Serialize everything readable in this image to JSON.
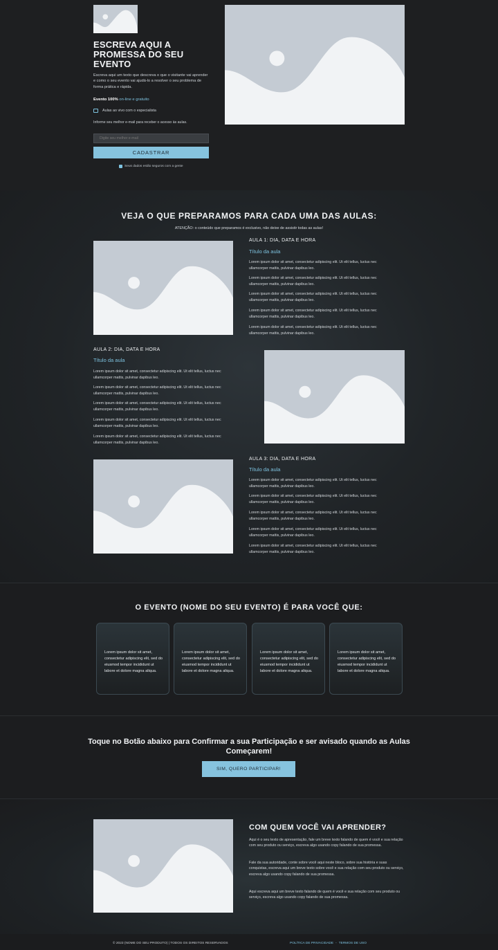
{
  "hero": {
    "title": "ESCREVA AQUI A PROMESSA DO SEU EVENTO",
    "description": "Escreva aqui um texto que descreva o que o visitante vai aprender e como o seu evento vai ajudá-lo a resolver o seu problema de forma prática e rápida.",
    "free_prefix": "Evento 100%",
    "free_highlight": "on-line e gratuito",
    "live_text": "Aulas ao vivo com o especialista",
    "info_text": "Informe seu melhor e-mail para receber o acesso às aulas.",
    "email_placeholder": "Digite seu melhor e-mail",
    "submit_label": "CADASTRAR",
    "secure_text": "Seus dados estão seguros com a gente"
  },
  "aulas": {
    "title": "VEJA O QUE PREPARAMOS PARA CADA UMA DAS AULAS:",
    "subtitle": "ATENÇÃO: o conteúdo que preparamos é exclusivo, não deixe de assistir todas as aulas!",
    "items": [
      {
        "heading": "AULA 1: DIA, DATA E HORA",
        "subtitle": "Título da aula",
        "paragraphs": [
          "Lorem ipsum dolor sit amet, consectetur adipiscing elit. Ut elit tellus, luctus nec ullamcorper mattis, pulvinar dapibus leo.",
          "Lorem ipsum dolor sit amet, consectetur adipiscing elit. Ut elit tellus, luctus nec ullamcorper mattis, pulvinar dapibus leo.",
          "Lorem ipsum dolor sit amet, consectetur adipiscing elit. Ut elit tellus, luctus nec ullamcorper mattis, pulvinar dapibus leo.",
          "Lorem ipsum dolor sit amet, consectetur adipiscing elit. Ut elit tellus, luctus nec ullamcorper mattis, pulvinar dapibus leo.",
          "Lorem ipsum dolor sit amet, consectetur adipiscing elit. Ut elit tellus, luctus nec ullamcorper mattis, pulvinar dapibus leo."
        ]
      },
      {
        "heading": "AULA 2: DIA, DATA E HORA",
        "subtitle": "Título da aula",
        "paragraphs": [
          "Lorem ipsum dolor sit amet, consectetur adipiscing elit. Ut elit tellus, luctus nec ullamcorper mattis, pulvinar dapibus leo.",
          "Lorem ipsum dolor sit amet, consectetur adipiscing elit. Ut elit tellus, luctus nec ullamcorper mattis, pulvinar dapibus leo.",
          "Lorem ipsum dolor sit amet, consectetur adipiscing elit. Ut elit tellus, luctus nec ullamcorper mattis, pulvinar dapibus leo.",
          "Lorem ipsum dolor sit amet, consectetur adipiscing elit. Ut elit tellus, luctus nec ullamcorper mattis, pulvinar dapibus leo.",
          "Lorem ipsum dolor sit amet, consectetur adipiscing elit. Ut elit tellus, luctus nec ullamcorper mattis, pulvinar dapibus leo."
        ]
      },
      {
        "heading": "AULA 3: DIA, DATA E HORA",
        "subtitle": "Título da aula",
        "paragraphs": [
          "Lorem ipsum dolor sit amet, consectetur adipiscing elit. Ut elit tellus, luctus nec ullamcorper mattis, pulvinar dapibus leo.",
          "Lorem ipsum dolor sit amet, consectetur adipiscing elit. Ut elit tellus, luctus nec ullamcorper mattis, pulvinar dapibus leo.",
          "Lorem ipsum dolor sit amet, consectetur adipiscing elit. Ut elit tellus, luctus nec ullamcorper mattis, pulvinar dapibus leo.",
          "Lorem ipsum dolor sit amet, consectetur adipiscing elit. Ut elit tellus, luctus nec ullamcorper mattis, pulvinar dapibus leo.",
          "Lorem ipsum dolor sit amet, consectetur adipiscing elit. Ut elit tellus, luctus nec ullamcorper mattis, pulvinar dapibus leo."
        ]
      }
    ]
  },
  "foryou": {
    "title": "O EVENTO (NOME DO SEU EVENTO) É PARA VOCÊ QUE:",
    "cards": [
      "Lorem ipsum dolor sit amet, consectetur adipiscing elit, sed do eiusmod tempor incididunt ut labore et dolore magna aliqua.",
      "Lorem ipsum dolor sit amet, consectetur adipiscing elit, sed do eiusmod tempor incididunt ut labore et dolore magna aliqua.",
      "Lorem ipsum dolor sit amet, consectetur adipiscing elit, sed do eiusmod tempor incididunt ut labore et dolore magna aliqua.",
      "Lorem ipsum dolor sit amet, consectetur adipiscing elit, sed do eiusmod tempor incididunt ut labore et dolore magna aliqua."
    ]
  },
  "cta": {
    "title": "Toque no Botão abaixo para Confirmar a sua Participação e ser avisado quando as Aulas Começarem!",
    "button_label": "SIM, QUERO PARTICIPAR!"
  },
  "instructor": {
    "title": "COM QUEM VOCÊ VAI APRENDER?",
    "paragraphs": [
      "Aqui é o seu texto de apresentação, fale um breve texto falando de quem é você e sua relação com seu produto ou serviço, escreva algo usando copy falando de sua promessa.",
      "Fale da sua autoridade, conte sobre você aqui neste bloco, sobre sua história e suas conquistas, escreva aqui um breve texto sobre você e sua relação com seu produto ou serviço, escreva algo usando copy falando de sua promessa.",
      "Aqui escreva aqui um breve texto falando de quem é você e sua relação com seu produto ou serviço, escreva algo usando copy falando de sua promessa."
    ]
  },
  "footer": {
    "copyright": "© 2023 (NOME DO SEU PRODUTO) | TODOS OS DIREITOS RESERVADOS",
    "privacy": "POLÍTICA DE PRIVACIDADE",
    "separator": "-",
    "terms": "TERMOS DE USO"
  },
  "colors": {
    "accent": "#86c3de",
    "background": "#1b1c1e",
    "placeholder": "#c4cbd3"
  }
}
